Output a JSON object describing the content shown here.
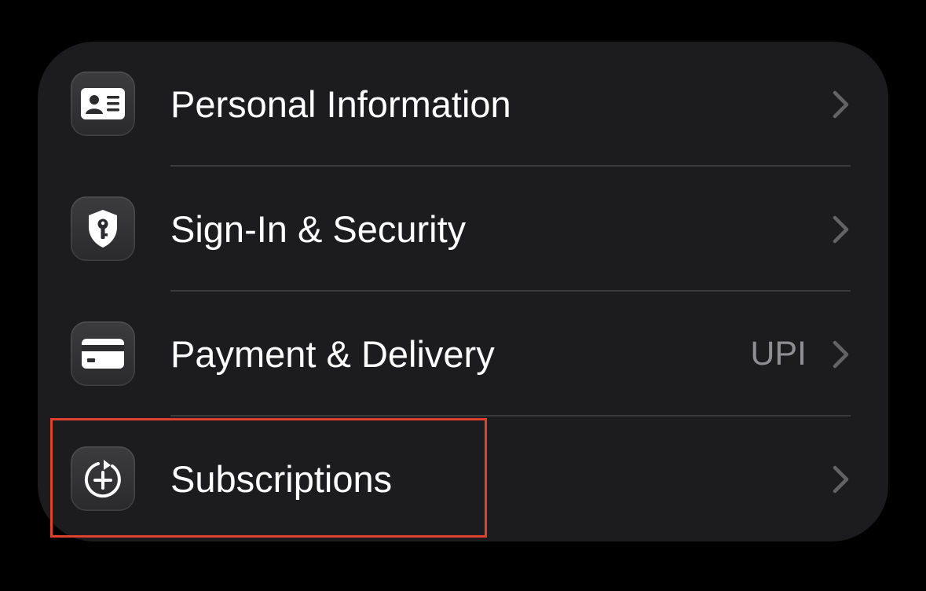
{
  "settings_list": {
    "items": [
      {
        "label": "Personal Information",
        "value": "",
        "icon": "id-card-icon"
      },
      {
        "label": "Sign-In & Security",
        "value": "",
        "icon": "shield-key-icon"
      },
      {
        "label": "Payment & Delivery",
        "value": "UPI",
        "icon": "credit-card-icon"
      },
      {
        "label": "Subscriptions",
        "value": "",
        "icon": "subscription-plus-icon"
      }
    ]
  },
  "colors": {
    "background": "#000000",
    "card": "#1c1c1e",
    "label": "#ffffff",
    "secondary": "#8e8e93",
    "separator": "#3a3a3c",
    "highlight": "#e0412e"
  }
}
